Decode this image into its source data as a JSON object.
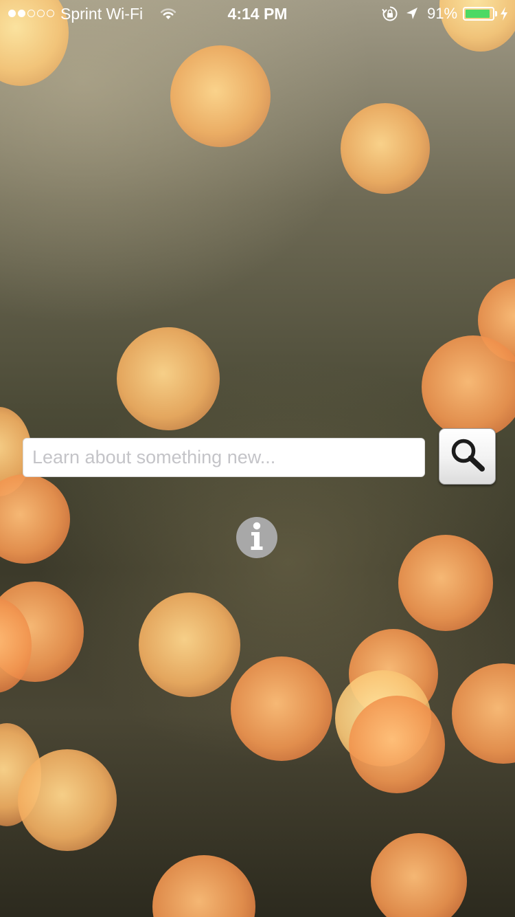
{
  "status_bar": {
    "signal_bars_filled": 2,
    "signal_bars_total": 5,
    "carrier": "Sprint Wi-Fi",
    "time": "4:14 PM",
    "battery_percent": "91%",
    "battery_level": 0.91,
    "battery_color": "#4cd964",
    "icons": [
      "wifi-icon",
      "rotation-lock-icon",
      "location-arrow-icon",
      "battery-icon",
      "charging-bolt-icon"
    ]
  },
  "search": {
    "placeholder": "Learn about something new...",
    "value": "",
    "button_icon": "magnifying-glass-icon"
  },
  "info": {
    "icon": "info-icon",
    "glyph": "i"
  },
  "background": {
    "description_colors": [
      "#f4b062",
      "#e2763c",
      "#4b4a36"
    ]
  }
}
